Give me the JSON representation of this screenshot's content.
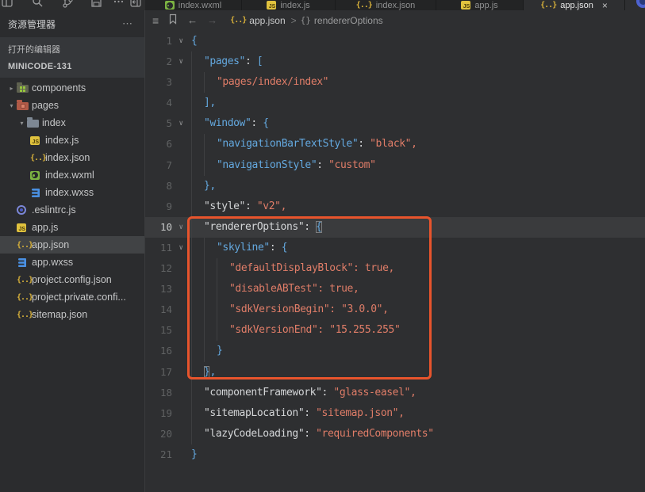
{
  "colors": {
    "annotation_orange": "#e8542c",
    "key_blue": "#64a9e0",
    "string_salmon": "#e07d68",
    "punct_white": "#d4d6d8",
    "icon_yellow": "#e0c23e",
    "wxml_green": "#7cb342",
    "wxss_blue": "#4a90e2",
    "eslint_purple": "#7b87d8",
    "selection_gray": "#414345"
  },
  "icons": {
    "fold": "∨",
    "chev_collapsed": "▸",
    "chev_expanded": "▾",
    "more": "⋯",
    "back": "←",
    "forward": "→",
    "outline": "≡",
    "close": "×",
    "json_braces": "{..}",
    "object_braces": "{}",
    "js_label": "JS"
  },
  "header": {
    "toolbar_icons": [
      "window-grid-icon",
      "search-icon",
      "git-branch-icon",
      "save-icon",
      "more-icon",
      "panel-toggle-icon"
    ]
  },
  "tabs": [
    {
      "label": "index.wxml",
      "icon": "wxml",
      "active": false
    },
    {
      "label": "index.js",
      "icon": "js",
      "active": false
    },
    {
      "label": "index.json",
      "icon": "json",
      "active": false
    },
    {
      "label": "app.js",
      "icon": "js",
      "active": false
    },
    {
      "label": "app.json",
      "icon": "json",
      "active": true
    }
  ],
  "breadcrumb": {
    "file": "app.json",
    "separator": ">",
    "symbol": "rendererOptions"
  },
  "sidebar": {
    "title": "资源管理器",
    "section_open_editors": "打开的编辑器",
    "section_project": "MINICODE-131",
    "tree": [
      {
        "label": "components",
        "icon": "folder-components",
        "chevron": "collapsed",
        "level": 0
      },
      {
        "label": "pages",
        "icon": "folder-pages",
        "chevron": "expanded",
        "level": 0
      },
      {
        "label": "index",
        "icon": "folder-plain",
        "chevron": "expanded",
        "level": 1
      },
      {
        "label": "index.js",
        "icon": "js",
        "level": 2
      },
      {
        "label": "index.json",
        "icon": "json",
        "level": 2
      },
      {
        "label": "index.wxml",
        "icon": "wxml",
        "level": 2
      },
      {
        "label": "index.wxss",
        "icon": "wxss",
        "level": 2
      },
      {
        "label": ".eslintrc.js",
        "icon": "eslint",
        "level": 0
      },
      {
        "label": "app.js",
        "icon": "js",
        "level": 0
      },
      {
        "label": "app.json",
        "icon": "json",
        "level": 0,
        "selected": true
      },
      {
        "label": "app.wxss",
        "icon": "wxss",
        "level": 0
      },
      {
        "label": "project.config.json",
        "icon": "json",
        "level": 0
      },
      {
        "label": "project.private.confi...",
        "icon": "json",
        "level": 0
      },
      {
        "label": "sitemap.json",
        "icon": "json",
        "level": 0
      }
    ]
  },
  "editor": {
    "language": "json",
    "lines": [
      {
        "n": 1,
        "indent": 0,
        "fold": true,
        "tokens": [
          {
            "t": "{",
            "c": "b"
          }
        ]
      },
      {
        "n": 2,
        "indent": 1,
        "fold": true,
        "tokens": [
          {
            "t": "\"pages\"",
            "c": "b"
          },
          {
            "t": ": ",
            "c": "w"
          },
          {
            "t": "[",
            "c": "b"
          }
        ]
      },
      {
        "n": 3,
        "indent": 2,
        "tokens": [
          {
            "t": "\"pages/index/index\"",
            "c": "s"
          }
        ]
      },
      {
        "n": 4,
        "indent": 1,
        "tokens": [
          {
            "t": "],",
            "c": "b"
          }
        ]
      },
      {
        "n": 5,
        "indent": 1,
        "fold": true,
        "tokens": [
          {
            "t": "\"window\"",
            "c": "b"
          },
          {
            "t": ": ",
            "c": "w"
          },
          {
            "t": "{",
            "c": "b"
          }
        ]
      },
      {
        "n": 6,
        "indent": 2,
        "tokens": [
          {
            "t": "\"navigationBarTextStyle\"",
            "c": "b"
          },
          {
            "t": ": ",
            "c": "w"
          },
          {
            "t": "\"black\",",
            "c": "s"
          }
        ]
      },
      {
        "n": 7,
        "indent": 2,
        "tokens": [
          {
            "t": "\"navigationStyle\"",
            "c": "b"
          },
          {
            "t": ": ",
            "c": "w"
          },
          {
            "t": "\"custom\"",
            "c": "s"
          }
        ]
      },
      {
        "n": 8,
        "indent": 1,
        "tokens": [
          {
            "t": "},",
            "c": "b"
          }
        ]
      },
      {
        "n": 9,
        "indent": 1,
        "tokens": [
          {
            "t": "\"style\"",
            "c": "w"
          },
          {
            "t": ": ",
            "c": "w"
          },
          {
            "t": "\"v2\",",
            "c": "s"
          }
        ]
      },
      {
        "n": 10,
        "indent": 1,
        "fold": true,
        "current": true,
        "tokens": [
          {
            "t": "\"rendererOptions\"",
            "c": "w"
          },
          {
            "t": ": ",
            "c": "w"
          },
          {
            "t": "{",
            "c": "b",
            "box": true
          }
        ]
      },
      {
        "n": 11,
        "indent": 2,
        "fold": true,
        "tokens": [
          {
            "t": "\"skyline\"",
            "c": "b"
          },
          {
            "t": ": ",
            "c": "w"
          },
          {
            "t": "{",
            "c": "b"
          }
        ]
      },
      {
        "n": 12,
        "indent": 3,
        "tokens": [
          {
            "t": "\"defaultDisplayBlock\"",
            "c": "s"
          },
          {
            "t": ": ",
            "c": "s"
          },
          {
            "t": "true,",
            "c": "s"
          }
        ]
      },
      {
        "n": 13,
        "indent": 3,
        "tokens": [
          {
            "t": "\"disableABTest\"",
            "c": "s"
          },
          {
            "t": ": ",
            "c": "s"
          },
          {
            "t": "true,",
            "c": "s"
          }
        ]
      },
      {
        "n": 14,
        "indent": 3,
        "tokens": [
          {
            "t": "\"sdkVersionBegin\"",
            "c": "s"
          },
          {
            "t": ": ",
            "c": "s"
          },
          {
            "t": "\"3.0.0\",",
            "c": "s"
          }
        ]
      },
      {
        "n": 15,
        "indent": 3,
        "tokens": [
          {
            "t": "\"sdkVersionEnd\"",
            "c": "s"
          },
          {
            "t": ": ",
            "c": "s"
          },
          {
            "t": "\"15.255.255\"",
            "c": "s"
          }
        ]
      },
      {
        "n": 16,
        "indent": 2,
        "tokens": [
          {
            "t": "}",
            "c": "b"
          }
        ]
      },
      {
        "n": 17,
        "indent": 1,
        "tokens": [
          {
            "t": "}",
            "c": "b",
            "box": true
          },
          {
            "t": ",",
            "c": "b"
          }
        ]
      },
      {
        "n": 18,
        "indent": 1,
        "tokens": [
          {
            "t": "\"componentFramework\"",
            "c": "w"
          },
          {
            "t": ": ",
            "c": "w"
          },
          {
            "t": "\"glass-easel\",",
            "c": "s"
          }
        ]
      },
      {
        "n": 19,
        "indent": 1,
        "tokens": [
          {
            "t": "\"sitemapLocation\"",
            "c": "w"
          },
          {
            "t": ": ",
            "c": "w"
          },
          {
            "t": "\"sitemap.json\",",
            "c": "s"
          }
        ]
      },
      {
        "n": 20,
        "indent": 1,
        "tokens": [
          {
            "t": "\"lazyCodeLoading\"",
            "c": "w"
          },
          {
            "t": ": ",
            "c": "w"
          },
          {
            "t": "\"requiredComponents\"",
            "c": "s"
          }
        ]
      },
      {
        "n": 21,
        "indent": 0,
        "tokens": [
          {
            "t": "}",
            "c": "b"
          }
        ]
      }
    ],
    "annotation": {
      "type": "highlight-box",
      "color": "#e8542c",
      "covers_lines": "10-17",
      "covers_key": "rendererOptions"
    }
  }
}
